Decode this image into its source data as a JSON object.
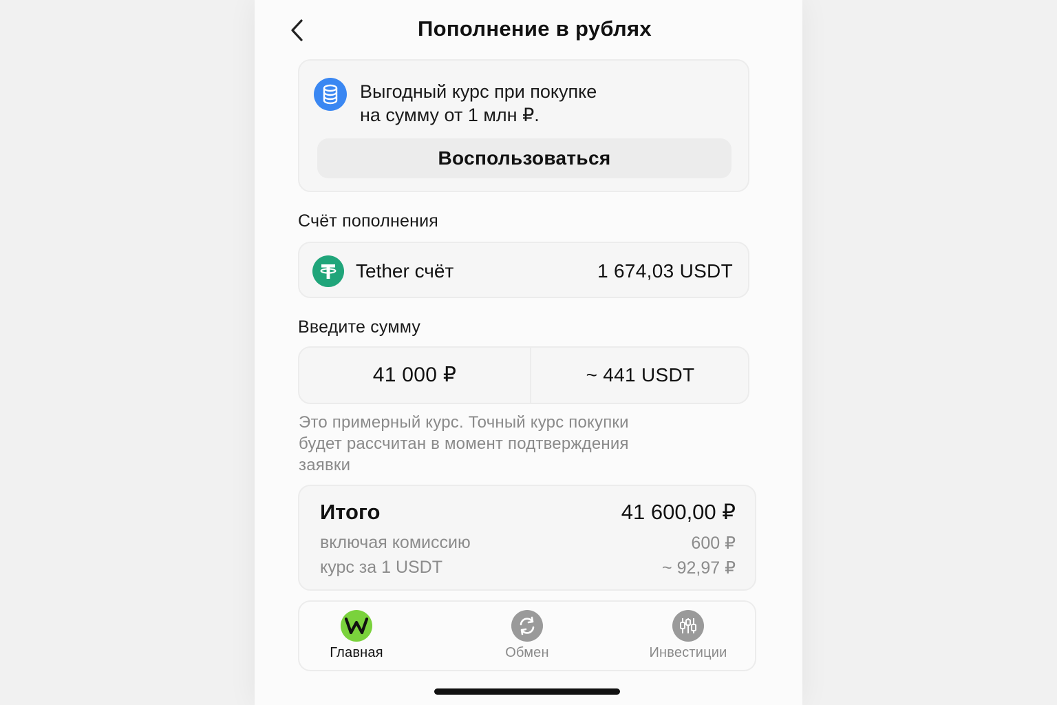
{
  "header": {
    "title": "Пополнение в рублях"
  },
  "promo": {
    "text_line1": "Выгодный курс при покупке",
    "text_line2": "на сумму от 1 млн ₽.",
    "button_label": "Воспользоваться",
    "icon": "coins-icon",
    "icon_color": "#3a87f2"
  },
  "account_section": {
    "label": "Счёт пополнения",
    "account_name": "Tether счёт",
    "balance": "1 674,03 USDT",
    "icon": "tether-icon",
    "icon_color": "#20a57a"
  },
  "amount_section": {
    "label": "Введите сумму",
    "rub_value": "41 000 ₽",
    "usdt_value": "~ 441 USDT"
  },
  "hint": {
    "line1": "Это примерный курс. Точный курс покупки",
    "line2": "будет рассчитан в момент подтверждения",
    "line3": "заявки"
  },
  "total": {
    "label": "Итого",
    "value": "41 600,00 ₽",
    "fee_label": "включая комиссию",
    "fee_value": "600 ₽",
    "rate_label": "курс за 1 USDT",
    "rate_value": "~ 92,97 ₽"
  },
  "nav": {
    "items": [
      {
        "label": "Главная",
        "icon": "w-logo-icon",
        "active": true
      },
      {
        "label": "Обмен",
        "icon": "exchange-icon",
        "active": false
      },
      {
        "label": "Инвестиции",
        "icon": "investments-icon",
        "active": false
      }
    ]
  },
  "colors": {
    "accent_green": "#7ad23c",
    "tether_green": "#20a57a",
    "blue": "#3a87f2",
    "muted": "#8a8a8a"
  }
}
